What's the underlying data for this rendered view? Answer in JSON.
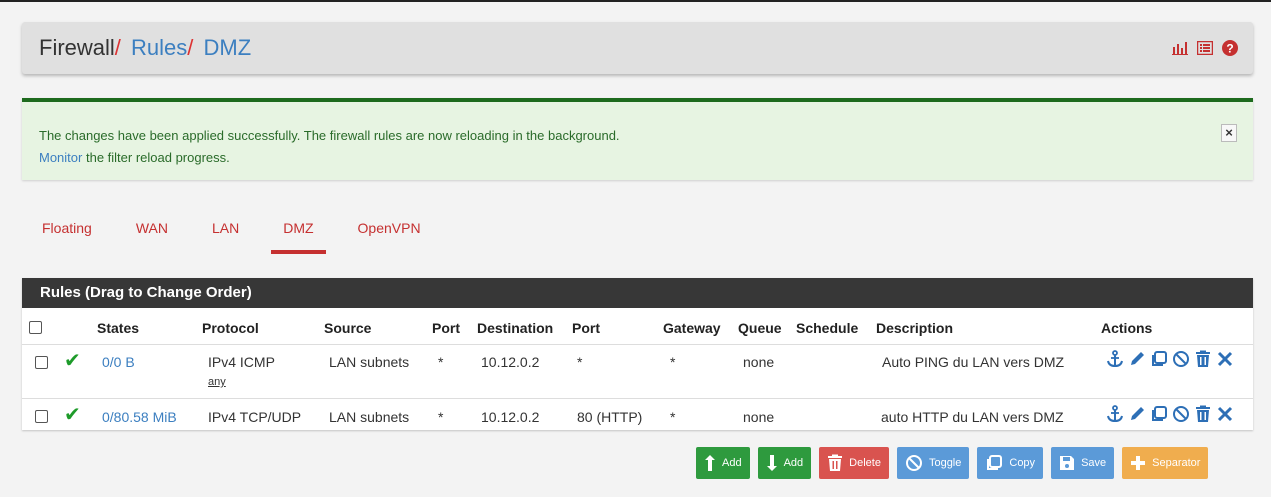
{
  "breadcrumb": {
    "root": "Firewall",
    "sep1": "/",
    "mid": "Rules",
    "sep2": "/",
    "current": "DMZ"
  },
  "header_icons": [
    "chart-icon",
    "list-icon",
    "help-icon"
  ],
  "alert": {
    "text": "The changes have been applied successfully. The firewall rules are now reloading in the background.",
    "link": "Monitor",
    "link_suffix": " the filter reload progress.",
    "close": "×"
  },
  "tabs": [
    {
      "label": "Floating"
    },
    {
      "label": "WAN"
    },
    {
      "label": "LAN"
    },
    {
      "label": "DMZ",
      "active": true
    },
    {
      "label": "OpenVPN"
    }
  ],
  "panel": {
    "title": "Rules (Drag to Change Order)",
    "columns": [
      "States",
      "Protocol",
      "Source",
      "Port",
      "Destination",
      "Port",
      "Gateway",
      "Queue",
      "Schedule",
      "Description",
      "Actions"
    ],
    "rows": [
      {
        "states": "0/0 B",
        "protocol": "IPv4 ICMP",
        "protocol_sub": "any",
        "source": "LAN subnets",
        "src_port": "*",
        "destination": "10.12.0.2",
        "dst_port": "*",
        "gateway": "*",
        "queue": "none",
        "schedule": "",
        "description": "Auto PING du LAN vers DMZ"
      },
      {
        "states": "0/80.58 MiB",
        "protocol": "IPv4 TCP/UDP",
        "protocol_sub": "",
        "source": "LAN subnets",
        "src_port": "*",
        "destination": "10.12.0.2",
        "dst_port": "80 (HTTP)",
        "gateway": "*",
        "queue": "none",
        "schedule": "",
        "description": "auto HTTP du LAN vers DMZ"
      }
    ]
  },
  "buttons": {
    "add_top": "Add",
    "add_bottom": "Add",
    "delete": "Delete",
    "toggle": "Toggle",
    "copy": "Copy",
    "save": "Save",
    "separator": "Separator"
  },
  "colors": {
    "accent_red": "#c53030",
    "link_blue": "#3c7fc0",
    "success_green": "#1d6a1d",
    "panel_dark": "#373737"
  }
}
